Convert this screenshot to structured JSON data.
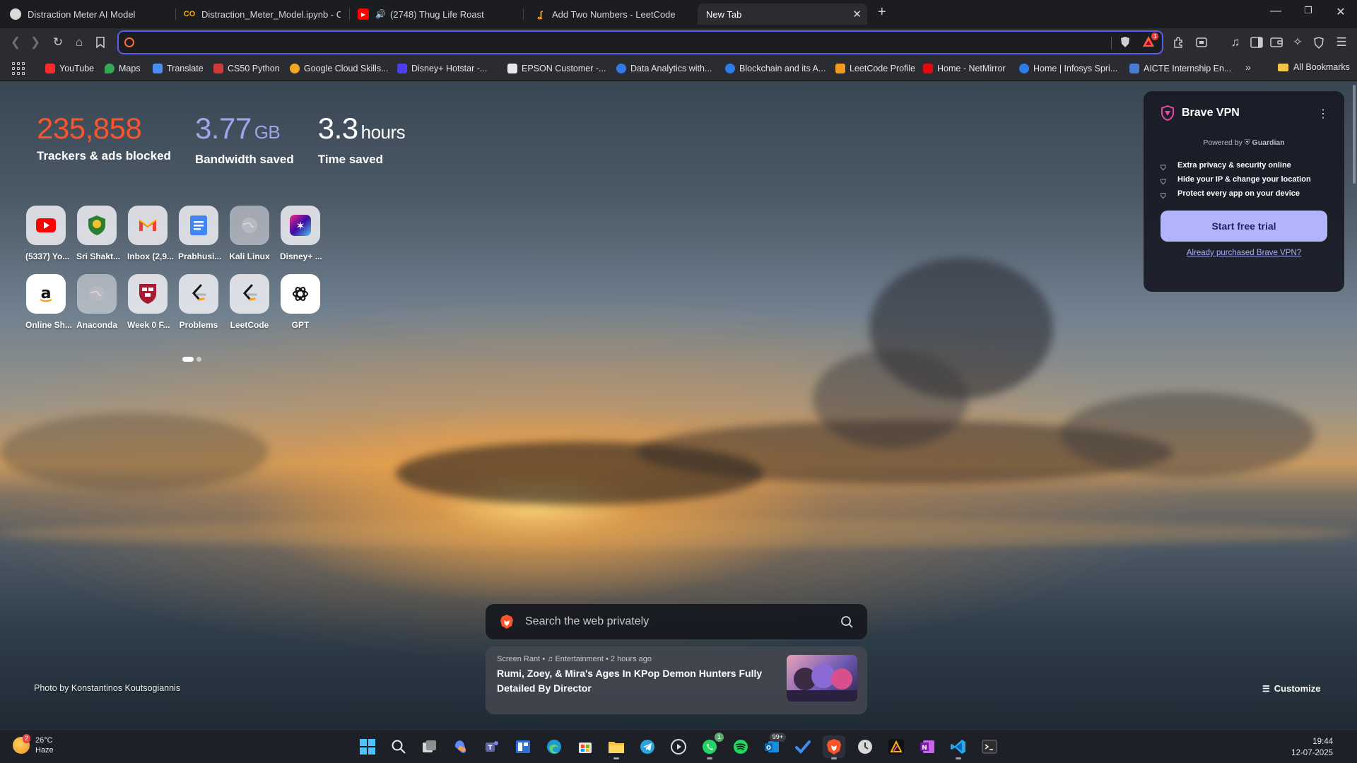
{
  "tabs": [
    {
      "label": "Distraction Meter AI Model",
      "active": false
    },
    {
      "label": "Distraction_Meter_Model.ipynb - Col",
      "active": false
    },
    {
      "label": "(2748) Thug Life Roast",
      "active": false
    },
    {
      "label": "Add Two Numbers - LeetCode",
      "active": false
    },
    {
      "label": "New Tab",
      "active": true
    }
  ],
  "toolbar": {
    "bat_badge": "1"
  },
  "bookmarks": [
    {
      "label": "YouTube",
      "color": "#ff2b2b"
    },
    {
      "label": "Maps",
      "color": "#34a853"
    },
    {
      "label": "Translate",
      "color": "#4d8cf5"
    },
    {
      "label": "CS50 Python",
      "color": "#d13a3a"
    },
    {
      "label": "Google Cloud Skills...",
      "color": "#f5a623"
    },
    {
      "label": "Disney+ Hotstar -...",
      "color": "#4b3ff0"
    },
    {
      "label": "EPSON Customer -...",
      "color": "#e8e8e8"
    },
    {
      "label": "Data Analytics with...",
      "color": "#2f7be8"
    },
    {
      "label": "Blockchain and its A...",
      "color": "#2f7be8"
    },
    {
      "label": "LeetCode Profile",
      "color": "#f29a1b"
    },
    {
      "label": "Home - NetMirror",
      "color": "#e50914"
    },
    {
      "label": "Home | Infosys Spri...",
      "color": "#2f7be8"
    },
    {
      "label": "AICTE Internship En...",
      "color": "#4a7bd1"
    }
  ],
  "bookmarks_all": "All Bookmarks",
  "stats": {
    "trackers": {
      "value": "235,858",
      "label": "Trackers & ads blocked",
      "color": "#fb542b"
    },
    "bandwidth": {
      "value": "3.77",
      "unit": "GB",
      "label": "Bandwidth saved",
      "color": "#a0a5eb"
    },
    "time": {
      "value": "3.3",
      "unit": "hours",
      "label": "Time saved",
      "color": "#ffffff"
    }
  },
  "tiles": [
    {
      "label": "(5337) Yo...",
      "icon": "youtube-icon"
    },
    {
      "label": "Sri Shakt...",
      "icon": "crest-icon"
    },
    {
      "label": "Inbox (2,9...",
      "icon": "gmail-icon"
    },
    {
      "label": "Prabhusi...",
      "icon": "docs-icon"
    },
    {
      "label": "Kali Linux",
      "icon": "globe-icon"
    },
    {
      "label": "Disney+ ...",
      "icon": "disney-icon"
    },
    {
      "label": "Online Sh...",
      "icon": "amazon-icon"
    },
    {
      "label": "Anaconda",
      "icon": "globe-icon"
    },
    {
      "label": "Week 0 F...",
      "icon": "harvard-icon"
    },
    {
      "label": "Problems",
      "icon": "leetcode-icon"
    },
    {
      "label": "LeetCode",
      "icon": "leetcode-icon"
    },
    {
      "label": "GPT",
      "icon": "openai-icon"
    }
  ],
  "vpn": {
    "title": "Brave VPN",
    "powered": "Powered by",
    "powered_brand": "Guardian",
    "features": [
      "Extra privacy & security online",
      "Hide your IP & change your location",
      "Protect every app on your device"
    ],
    "cta": "Start free trial",
    "link": "Already purchased Brave VPN?"
  },
  "search": {
    "placeholder": "Search the web privately"
  },
  "news": {
    "source": "Screen Rant",
    "category": "Entertainment",
    "time": "2 hours ago",
    "title": "Rumi, Zoey, & Mira's Ages In KPop Demon Hunters Fully Detailed By Director"
  },
  "photo_credit": "Photo by Konstantinos Koutsogiannis",
  "customize": "Customize",
  "taskbar": {
    "temp": "26°C",
    "condition": "Haze",
    "weather_badge": "2",
    "whatsapp_badge": "1",
    "outlook_badge": "99+",
    "time": "19:44",
    "date": "12-07-2025"
  }
}
